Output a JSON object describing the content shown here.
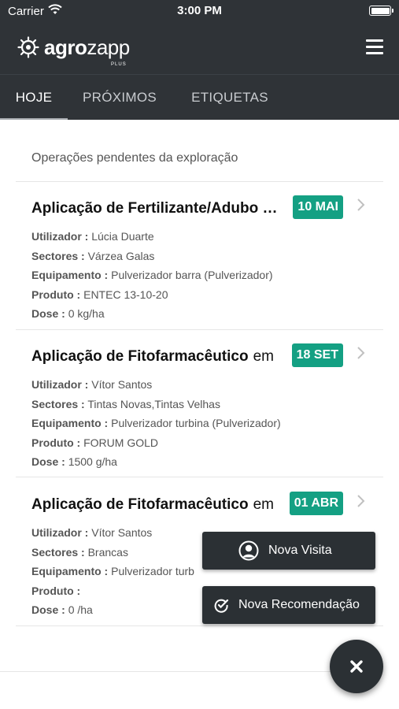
{
  "status_bar": {
    "carrier": "Carrier",
    "time": "3:00 PM"
  },
  "app": {
    "logo_bold": "agro",
    "logo_rest": "zapp",
    "logo_sub": "PLUS"
  },
  "tabs": [
    {
      "label": "HOJE",
      "active": true
    },
    {
      "label": "PRÓXIMOS",
      "active": false
    },
    {
      "label": "ETIQUETAS",
      "active": false
    }
  ],
  "section_title": "Operações pendentes da exploração",
  "operations": [
    {
      "title": "Aplicação de Fertilizante/Adubo …",
      "title_suffix": "",
      "date_badge": "10 MAI",
      "fields": [
        {
          "key": "Utilizador :",
          "value": "Lúcia Duarte"
        },
        {
          "key": "Sectores :",
          "value": "Várzea Galas"
        },
        {
          "key": "Equipamento :",
          "value": "Pulverizador barra (Pulverizador)"
        },
        {
          "key": "Produto :",
          "value": "ENTEC 13-10-20"
        },
        {
          "key": "Dose :",
          "value": "0 kg/ha"
        }
      ]
    },
    {
      "title": "Aplicação de Fitofarmacêutico",
      "title_suffix": "em",
      "date_badge": "18 SET",
      "fields": [
        {
          "key": "Utilizador :",
          "value": "Vítor Santos"
        },
        {
          "key": "Sectores :",
          "value": "Tintas Novas,Tintas Velhas"
        },
        {
          "key": "Equipamento :",
          "value": "Pulverizador turbina (Pulverizador)"
        },
        {
          "key": "Produto :",
          "value": "FORUM GOLD"
        },
        {
          "key": "Dose :",
          "value": "1500 g/ha"
        }
      ]
    },
    {
      "title": "Aplicação de Fitofarmacêutico",
      "title_suffix": "em",
      "date_badge": "01 ABR",
      "fields": [
        {
          "key": "Utilizador :",
          "value": "Vítor Santos"
        },
        {
          "key": "Sectores :",
          "value": "Brancas"
        },
        {
          "key": "Equipamento :",
          "value": "Pulverizador turb"
        },
        {
          "key": "Produto :",
          "value": ""
        },
        {
          "key": "Dose :",
          "value": "0 /ha"
        }
      ]
    }
  ],
  "fab_actions": {
    "visit_label": "Nova Visita",
    "recommendation_label": "Nova Recomendação"
  },
  "colors": {
    "bar": "#2f3337",
    "badge": "#14a083"
  }
}
